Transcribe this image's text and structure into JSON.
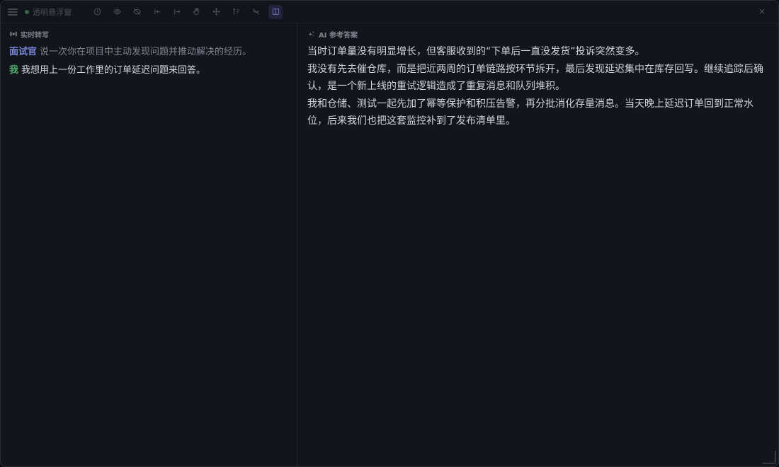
{
  "titlebar": {
    "title": "透明悬浮窗",
    "status_color": "#2f6b46",
    "tools": [
      {
        "icon": "clock-icon"
      },
      {
        "icon": "eye-icon"
      },
      {
        "icon": "eye-off-icon"
      },
      {
        "icon": "arrow-left-icon"
      },
      {
        "icon": "arrow-right-icon"
      },
      {
        "icon": "hand-icon"
      },
      {
        "icon": "move-icon"
      },
      {
        "icon": "sort-icon"
      },
      {
        "icon": "hide-icon"
      },
      {
        "icon": "split-view-icon"
      }
    ],
    "close_label": "×"
  },
  "transcript": {
    "header": "实时转写",
    "lines": [
      {
        "speaker": "面试官",
        "text": "说一次你在项目中主动发现问题并推动解决的经历。"
      },
      {
        "speaker": "我",
        "text": "我想用上一份工作里的订单延迟问题来回答。"
      }
    ]
  },
  "answer": {
    "header": "AI 参考答案",
    "paragraphs": [
      "当时订单量没有明显增长，但客服收到的“下单后一直没发货”投诉突然变多。",
      "我没有先去催仓库，而是把近两周的订单链路按环节拆开，最后发现延迟集中在库存回写。继续追踪后确认，是一个新上线的重试逻辑造成了重复消息和队列堆积。",
      "我和仓储、测试一起先加了幂等保护和积压告警，再分批消化存量消息。当天晚上延迟订单回到正常水位，后来我们也把这套监控补到了发布清单里。"
    ]
  },
  "colors": {
    "interviewer": "#7a86d8",
    "me": "#4cae6a",
    "accent": "#6f6fb0"
  }
}
